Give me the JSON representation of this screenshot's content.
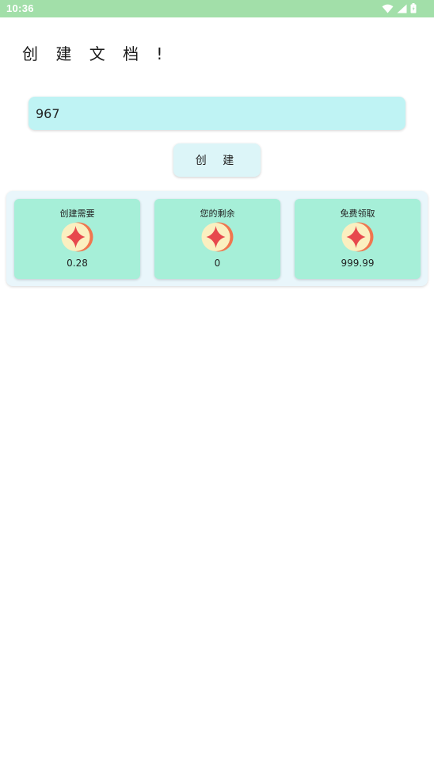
{
  "status_bar": {
    "time": "10:36",
    "icons": [
      "wifi-icon",
      "signal-icon",
      "battery-icon"
    ]
  },
  "page": {
    "title": "创 建 文 档 !"
  },
  "document_name_input": {
    "value": "967"
  },
  "create_button": {
    "label": "创 建"
  },
  "info_cards": [
    {
      "label": "创建需要",
      "icon": "coin-icon",
      "value": "0.28"
    },
    {
      "label": "您的剩余",
      "icon": "coin-icon",
      "value": "0"
    },
    {
      "label": "免费领取",
      "icon": "coin-icon",
      "value": "999.99"
    }
  ],
  "colors": {
    "status_bar": "#a2dfa9",
    "input_bg": "#bff3f4",
    "button_bg": "#dcf5f8",
    "panel_bg": "#e9f6fb",
    "card_bg": "#a6efd8",
    "coin_face": "#fbefc0",
    "coin_rim": "#f0764f",
    "coin_star": "#e7484d"
  }
}
